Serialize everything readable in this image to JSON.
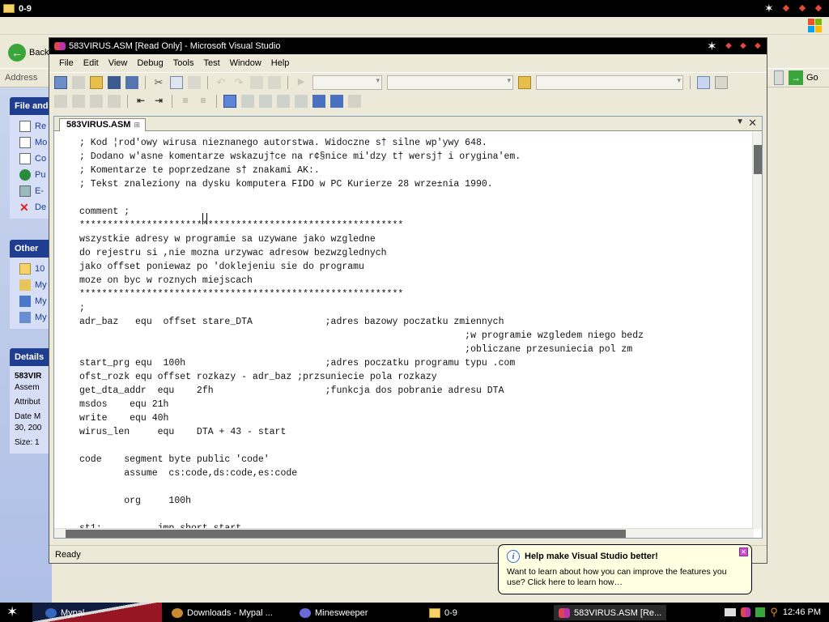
{
  "explorer": {
    "title": "0-9",
    "back_label": "Back",
    "address_label": "Address",
    "go_label": "Go",
    "panels": [
      {
        "title": "File and",
        "items": [
          "Re",
          "Mo",
          "Co",
          "Pu",
          "E-",
          "De"
        ]
      },
      {
        "title": "Other",
        "items": [
          "10",
          "My",
          "My",
          "My"
        ]
      },
      {
        "title": "Details",
        "details": [
          "583VIR",
          "Assem",
          "Attribut",
          "Date M",
          "30, 200",
          "Size: 1"
        ]
      }
    ]
  },
  "vs": {
    "title": "583VIRUS.ASM [Read Only] - Microsoft Visual Studio",
    "menu": [
      "File",
      "Edit",
      "View",
      "Debug",
      "Tools",
      "Test",
      "Window",
      "Help"
    ],
    "tab_label": "583VIRUS.ASM",
    "status": "Ready",
    "code_lines": [
      "; Kod ¦rod'owy wirusa nieznanego autorstwa. Widoczne s† silne wp'ywy 648.",
      "; Dodano w'asne komentarze wskazuj†ce na r¢§nice mi'dzy t† wersj† i orygina'em.",
      "; Komentarze te poprzedzane s† znakami AK:.",
      "; Tekst znaleziony na dysku komputera FIDO w PC Kurierze 28 wrze±nia 1990.",
      "",
      "comment ;",
      "**********************************************************",
      "wszystkie adresy w programie sa uzywane jako wzgledne",
      "do rejestru si ,nie mozna urzywac adresow bezwzglednych",
      "jako offset poniewaz po 'doklejeniu sie do programu",
      "moze on byc w roznych miejscach",
      "**********************************************************",
      ";",
      "adr_baz   equ  offset stare_DTA             ;adres bazowy poczatku zmiennych",
      "                                                                     ;w programie wzgledem niego bedz",
      "                                                                     ;obliczane przesuniecia pol zm",
      "start_prg equ  100h                         ;adres poczatku programu typu .com",
      "ofst_rozk equ offset rozkazy - adr_baz ;przsuniecie pola rozkazy",
      "get_dta_addr  equ    2fh                    ;funkcja dos pobranie adresu DTA",
      "msdos    equ 21h",
      "write    equ 40h",
      "wirus_len     equ    DTA + 43 - start",
      "",
      "code    segment byte public 'code'",
      "        assume  cs:code,ds:code,es:code",
      "",
      "        org     100h",
      "",
      "st1:          jmp short start"
    ]
  },
  "balloon": {
    "title": "Help make Visual Studio better!",
    "body": "Want to learn about how you can improve the features you use? Click here to learn how…"
  },
  "taskbar": {
    "buttons": [
      "Mypal",
      "Downloads - Mypal ...",
      "Minesweeper",
      "0-9",
      "583VIRUS.ASM [Re..."
    ],
    "clock": "12:46 PM"
  }
}
